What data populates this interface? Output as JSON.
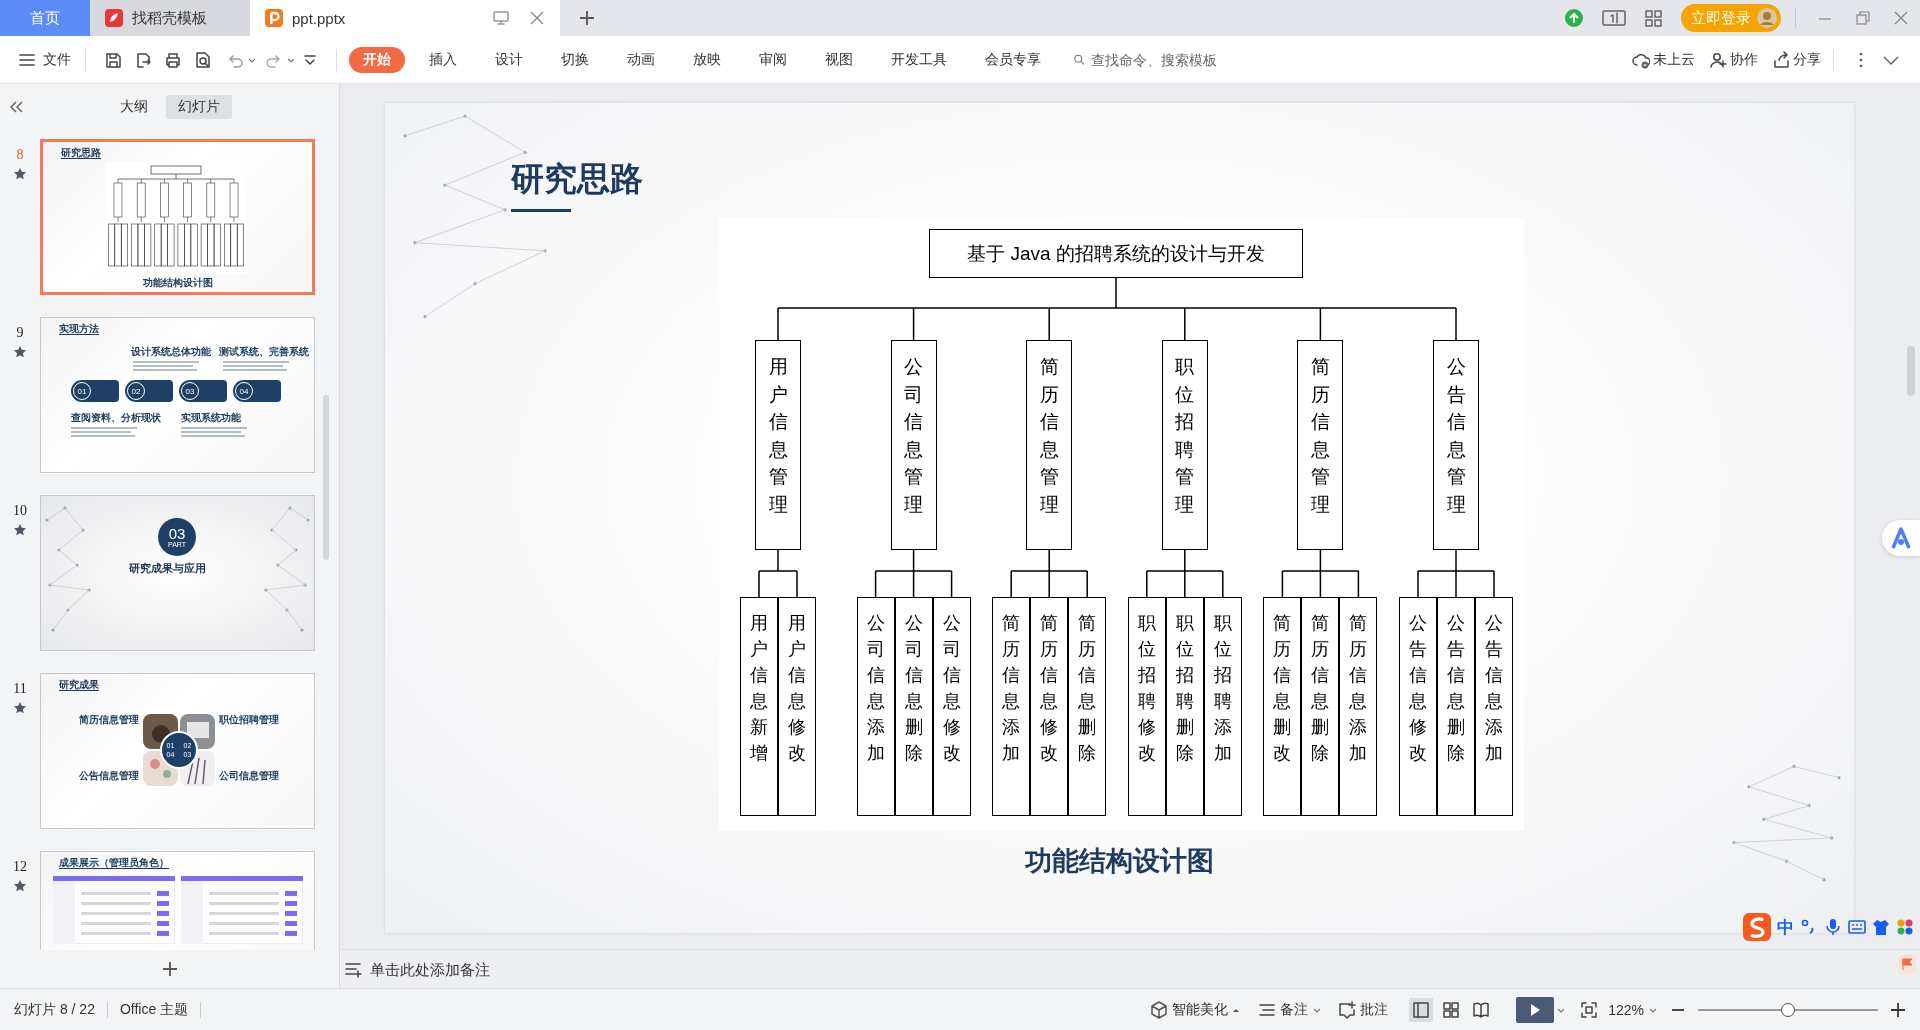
{
  "tabs": [
    {
      "label": "首页",
      "kind": "home",
      "selected": false
    },
    {
      "label": "找稻壳模板",
      "kind": "docer",
      "selected": false
    },
    {
      "label": "ppt.pptx",
      "kind": "file",
      "selected": true
    }
  ],
  "login_button": "立即登录",
  "toolbar": {
    "file_menu": "文件",
    "ribbon_tabs": [
      {
        "label": "开始",
        "selected": true
      },
      {
        "label": "插入",
        "selected": false
      },
      {
        "label": "设计",
        "selected": false
      },
      {
        "label": "切换",
        "selected": false
      },
      {
        "label": "动画",
        "selected": false
      },
      {
        "label": "放映",
        "selected": false
      },
      {
        "label": "审阅",
        "selected": false
      },
      {
        "label": "视图",
        "selected": false
      },
      {
        "label": "开发工具",
        "selected": false
      },
      {
        "label": "会员专享",
        "selected": false
      }
    ],
    "search": {
      "placeholder": "查找命令、搜索模板"
    },
    "actions": [
      {
        "label": "未上云",
        "kind": "cloud"
      },
      {
        "label": "协作",
        "kind": "collab"
      },
      {
        "label": "分享",
        "kind": "share"
      }
    ]
  },
  "panel": {
    "view_tabs": [
      {
        "label": "大纲",
        "selected": false
      },
      {
        "label": "幻灯片",
        "selected": true
      }
    ],
    "slides": [
      {
        "number": "8",
        "selected": true,
        "kind": "diagram",
        "title": "研究思路",
        "caption": "功能结构设计图"
      },
      {
        "number": "9",
        "selected": false,
        "kind": "steps",
        "title": "实现方法",
        "steps": [
          "01",
          "02",
          "03",
          "04"
        ],
        "labels": [
          "设计系统总体功能",
          "测试系统、完善系统",
          "查阅资料、分析现状",
          "实现系统功能"
        ]
      },
      {
        "number": "10",
        "selected": false,
        "kind": "section",
        "part": "03",
        "part_label": "PART",
        "title": "研究成果与应用"
      },
      {
        "number": "11",
        "selected": false,
        "kind": "photos",
        "title": "研究成果",
        "steps": [
          "01",
          "02",
          "04",
          "03"
        ],
        "labels": [
          "简历信息管理",
          "职位招聘管理",
          "公告信息管理",
          "公司信息管理"
        ]
      },
      {
        "number": "12",
        "selected": false,
        "kind": "screens",
        "title": "成果展示（管理员角色）"
      }
    ]
  },
  "slide": {
    "title": "研究思路",
    "diagram": {
      "root": "基于 Java 的招聘系统的设计与开发",
      "branches": [
        {
          "label": "用户信息管理",
          "children": [
            "用户信息新增",
            "用户信息修改"
          ]
        },
        {
          "label": "公司信息管理",
          "children": [
            "公司信息添加",
            "公司信息删除",
            "公司信息修改"
          ]
        },
        {
          "label": "简历信息管理",
          "children": [
            "简历信息添加",
            "简历信息修改",
            "简历信息删除"
          ]
        },
        {
          "label": "职位招聘管理",
          "children": [
            "职位招聘修改",
            "职位招聘删除",
            "职位招聘添加"
          ]
        },
        {
          "label": "简历信息管理",
          "children": [
            "简历信息删改",
            "简历信息删除",
            "简历信息添加"
          ]
        },
        {
          "label": "公告信息管理",
          "children": [
            "公告信息修改",
            "公告信息删除",
            "公告信息添加"
          ]
        }
      ]
    },
    "caption": "功能结构设计图"
  },
  "notes": {
    "placeholder": "单击此处添加备注"
  },
  "ime_bar": {
    "mode": "中"
  },
  "status_bar": {
    "slide_counter": "幻灯片 8 / 22",
    "theme": "Office 主题",
    "beautify": "智能美化",
    "notes": "备注",
    "comments": "批注",
    "zoom": "122%",
    "zoom_slider": {
      "level": 0.5
    }
  }
}
